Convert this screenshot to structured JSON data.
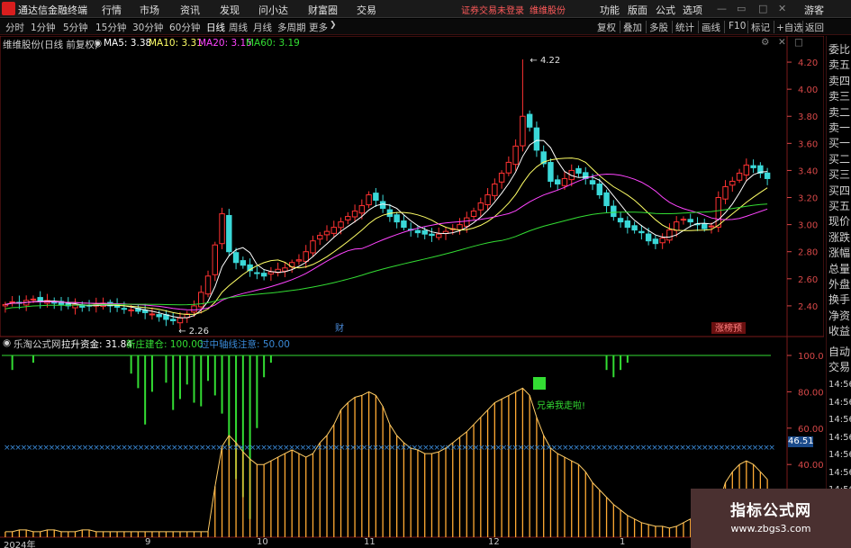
{
  "app": {
    "title": "通达信金融终端",
    "menu": [
      "行情",
      "市场",
      "资讯",
      "发现",
      "问小达",
      "财富圈",
      "交易"
    ],
    "notice1": "证券交易未登录",
    "notice2": "维维股份",
    "right_menu": [
      "功能",
      "版面",
      "公式",
      "选项"
    ],
    "user": "游客"
  },
  "periods": [
    "分时",
    "1分钟",
    "5分钟",
    "15分钟",
    "30分钟",
    "60分钟",
    "日线",
    "周线",
    "月线",
    "多周期",
    "更多"
  ],
  "active_period": "日线",
  "tools": [
    "复权",
    "叠加",
    "多股",
    "统计",
    "画线",
    "F10",
    "标记",
    "+自选",
    "返回"
  ],
  "main_legend": {
    "name": "维维股份(日线 前复权)",
    "ma5": "MA5: 3.38",
    "ma10": "MA10: 3.31",
    "ma20": "MA20: 3.15",
    "ma60": "MA60: 3.19"
  },
  "colors": {
    "up": "#ff3232",
    "down": "#3ad8d8",
    "ma5": "#ffffff",
    "ma10": "#ffff66",
    "ma20": "#ff44ff",
    "ma60": "#33dd33",
    "axis": "#d84848"
  },
  "price_axis": [
    "4.20",
    "4.00",
    "3.80",
    "3.60",
    "3.40",
    "3.20",
    "3.00",
    "2.80",
    "2.60",
    "2.40"
  ],
  "annotations": {
    "high": "4.22",
    "low": "2.26",
    "cai": "财",
    "zhangting": "涨榜预"
  },
  "indicator_legend": {
    "name": "乐淘公式网",
    "lasheng": "拉升资金: 31.84",
    "xinzhuang": "新庄建仓: 100.00",
    "guozhong": "过中轴线注意: 50.00"
  },
  "indicator_axis": [
    "100.0",
    "80.00",
    "60.00",
    "40.00"
  ],
  "indicator_badge": "46.51",
  "indicator_note": "兄弟我走啦!",
  "side_panel": [
    "委比",
    "卖五",
    "卖四",
    "卖三",
    "卖二",
    "卖一",
    "买一",
    "买二",
    "买三",
    "买四",
    "买五",
    "现价",
    "涨跌",
    "涨幅",
    "总量",
    "外盘",
    "换手",
    "净资",
    "收益"
  ],
  "side_lower": [
    "自动",
    "交易"
  ],
  "side_times": [
    "14:56",
    "14:56",
    "14:56",
    "14:56",
    "14:56",
    "14:56",
    "14:56",
    "14:56"
  ],
  "x_axis_labels": [
    "2024年",
    "9",
    "10",
    "11",
    "12",
    "1"
  ],
  "brand": {
    "line1": "指标公式网",
    "line2": "www.zbgs3.com"
  },
  "chart_data": {
    "type": "candlestick",
    "title": "维维股份(日线 前复权)",
    "ylim": [
      2.2,
      4.3
    ],
    "high_label": 4.22,
    "low_label": 2.26,
    "ma_last": {
      "MA5": 3.38,
      "MA10": 3.31,
      "MA20": 3.15,
      "MA60": 3.19
    },
    "closes": [
      2.41,
      2.43,
      2.42,
      2.44,
      2.45,
      2.43,
      2.44,
      2.42,
      2.41,
      2.4,
      2.41,
      2.39,
      2.4,
      2.41,
      2.42,
      2.4,
      2.39,
      2.38,
      2.37,
      2.36,
      2.35,
      2.34,
      2.32,
      2.3,
      2.29,
      2.31,
      2.34,
      2.4,
      2.5,
      2.62,
      2.85,
      3.08,
      2.8,
      2.72,
      2.7,
      2.66,
      2.64,
      2.62,
      2.65,
      2.67,
      2.68,
      2.72,
      2.74,
      2.8,
      2.88,
      2.92,
      2.95,
      2.98,
      3.02,
      3.06,
      3.1,
      3.14,
      3.22,
      3.18,
      3.12,
      3.06,
      3.02,
      2.98,
      2.96,
      2.94,
      2.93,
      2.92,
      2.93,
      2.95,
      2.97,
      3.0,
      3.05,
      3.1,
      3.16,
      3.22,
      3.3,
      3.38,
      3.46,
      3.58,
      3.8,
      3.72,
      3.55,
      3.45,
      3.32,
      3.3,
      3.34,
      3.4,
      3.38,
      3.34,
      3.3,
      3.22,
      3.14,
      3.06,
      3.02,
      2.98,
      2.96,
      2.94,
      2.88,
      2.86,
      2.9,
      2.96,
      3.02,
      3.04,
      3.02,
      3.0,
      2.97,
      2.99,
      3.2,
      3.28,
      3.32,
      3.38,
      3.44,
      3.42,
      3.38,
      3.34
    ],
    "indicator": {
      "type": "bar",
      "series": [
        "拉升资金",
        "新庄建仓",
        "过中轴线注意"
      ],
      "last_values": {
        "拉升资金": 31.84,
        "新庄建仓": 100.0,
        "过中轴线注意": 50.0
      },
      "ylim": [
        0,
        100
      ],
      "lasheng": [
        3,
        3,
        4,
        4,
        3,
        3,
        4,
        4,
        3,
        3,
        3,
        4,
        4,
        3,
        3,
        3,
        3,
        3,
        3,
        3,
        3,
        3,
        3,
        3,
        3,
        3,
        3,
        3,
        3,
        3,
        28,
        50,
        56,
        52,
        47,
        43,
        40,
        40,
        42,
        44,
        46,
        48,
        46,
        44,
        46,
        52,
        56,
        62,
        70,
        74,
        77,
        78,
        80,
        78,
        72,
        62,
        56,
        52,
        49,
        48,
        46,
        46,
        47,
        49,
        52,
        55,
        58,
        62,
        66,
        70,
        74,
        76,
        78,
        80,
        82,
        78,
        66,
        56,
        49,
        46,
        44,
        42,
        40,
        36,
        30,
        26,
        22,
        18,
        15,
        12,
        10,
        8,
        7,
        6,
        6,
        5,
        6,
        8,
        10,
        12,
        14,
        16,
        18,
        30,
        36,
        40,
        42,
        40,
        36,
        31.84
      ],
      "xinzhuang": [
        100,
        92,
        100,
        100,
        96,
        100,
        100,
        100,
        100,
        100,
        100,
        100,
        100,
        100,
        100,
        100,
        100,
        100,
        90,
        82,
        62,
        80,
        100,
        85,
        70,
        76,
        84,
        74,
        72,
        86,
        78,
        68,
        50,
        32,
        22,
        10,
        60,
        88,
        96,
        100,
        100,
        100,
        100,
        100,
        100,
        100,
        100,
        100,
        100,
        100,
        100,
        100,
        100,
        100,
        100,
        100,
        100,
        100,
        100,
        100,
        100,
        100,
        100,
        100,
        100,
        100,
        100,
        100,
        100,
        100,
        100,
        100,
        100,
        100,
        100,
        100,
        100,
        100,
        100,
        100,
        100,
        100,
        100,
        100,
        100,
        100,
        92,
        88,
        92,
        96,
        100,
        100,
        100,
        100,
        100,
        100,
        100,
        100,
        100,
        100,
        100,
        100,
        100,
        100,
        100,
        100,
        100,
        100,
        100,
        100
      ]
    }
  }
}
